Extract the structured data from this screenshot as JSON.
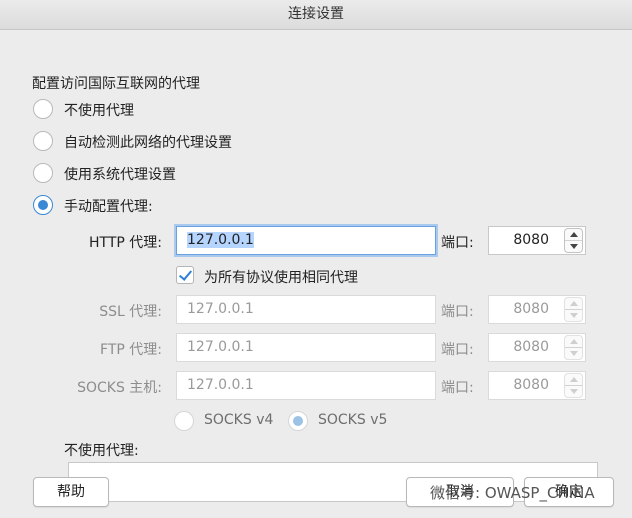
{
  "window": {
    "title": "连接设置"
  },
  "section_title": "配置访问国际互联网的代理",
  "proxy_modes": [
    {
      "label": "不使用代理",
      "selected": false
    },
    {
      "label": "自动检测此网络的代理设置",
      "selected": false
    },
    {
      "label": "使用系统代理设置",
      "selected": false
    },
    {
      "label": "手动配置代理:",
      "selected": true
    }
  ],
  "http": {
    "label": "HTTP 代理:",
    "value": "127.0.0.1",
    "port_label": "端口:",
    "port": "8080"
  },
  "same_proxy": {
    "label": "为所有协议使用相同代理",
    "checked": true
  },
  "ssl": {
    "label": "SSL 代理:",
    "value": "127.0.0.1",
    "port_label": "端口:",
    "port": "8080"
  },
  "ftp": {
    "label": "FTP 代理:",
    "value": "127.0.0.1",
    "port_label": "端口:",
    "port": "8080"
  },
  "socks": {
    "label": "SOCKS 主机:",
    "value": "127.0.0.1",
    "port_label": "端口:",
    "port": "8080"
  },
  "socks_versions": [
    {
      "label": "SOCKS v4",
      "selected": false
    },
    {
      "label": "SOCKS v5",
      "selected": true
    }
  ],
  "no_proxy": {
    "label": "不使用代理:",
    "value": ""
  },
  "buttons": {
    "help": "帮助",
    "cancel": "取消",
    "ok": "确定"
  },
  "watermark": "微信号: OWASP_CHINA"
}
